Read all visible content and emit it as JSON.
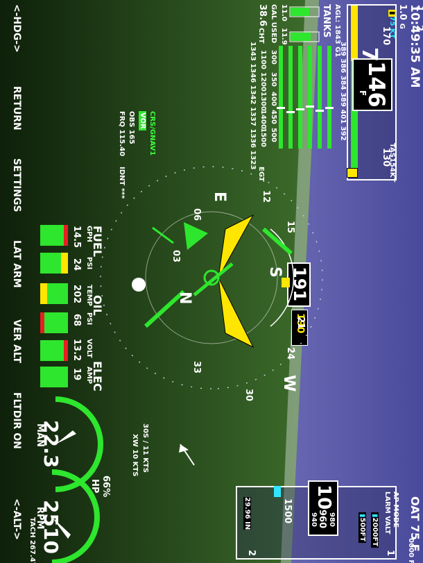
{
  "top_bar": {
    "time": "10:49:35 AM",
    "g_load": "1.0",
    "g_unit": "G",
    "oat": "OAT 75 F"
  },
  "airspeed": {
    "current": "146",
    "selected": "75",
    "selected_unit": "KT",
    "tas": "TAS154",
    "tas_unit": "KT",
    "trend": "7",
    "trend_sub": "F",
    "ticks": [
      "170",
      "160",
      "150",
      "140",
      "130"
    ]
  },
  "altitude": {
    "current_main": "10",
    "current_small": "960",
    "current_small_upper": "980",
    "current_small_lower": "940",
    "selected": "2000",
    "selected_unit": "FT",
    "vsi_select": "500",
    "vsi_unit": "FT",
    "vs_rate": "0000",
    "vs_unit": "FM",
    "baro": "29.96",
    "baro_unit": "IN",
    "ticks": [
      "1500"
    ],
    "scale_marks": [
      "2",
      "1",
      "1",
      "2"
    ],
    "ap_mode_line1": "AP MODE",
    "ap_mode_line2": "LARM VALT"
  },
  "heading": {
    "current": "191",
    "bug": "190",
    "compass_labels": [
      "S",
      "21",
      "24",
      "W",
      "30",
      "33",
      "N",
      "03",
      "06",
      "E",
      "12",
      "15"
    ]
  },
  "nav": {
    "source": "CRS/GNAV1",
    "mode": "VOR",
    "obs": "OBS 165",
    "freq": "FRQ 115.40",
    "ident": "IDNT ***"
  },
  "wind": {
    "line1": "30S / 11 KTS",
    "line2": "XW 10 KTS"
  },
  "engine": {
    "agl": "AGL: 1843 G1",
    "tanks_label": "TANKS",
    "tank_left": "11.0",
    "tank_right": "11.9",
    "gal_used_label": "GAL USED",
    "gal_used": "38.6",
    "cht_label": "CHT",
    "cht_values": [
      "1343",
      "1346",
      "1342",
      "1337",
      "1336",
      "1323"
    ],
    "egt_label": "EGT",
    "cht_scale": [
      "500",
      "450",
      "400",
      "350",
      "300"
    ],
    "egt_scale": [
      "1500",
      "1400",
      "1300",
      "1200",
      "1100"
    ],
    "egt_top_values": [
      "389",
      "386",
      "384",
      "389",
      "401",
      "392"
    ],
    "fuel_label": "FUEL",
    "oil_label": "OIL",
    "elec_label": "ELEC",
    "gph_label": "GPH",
    "psi_label": "PSI",
    "temp_label": "TEMP",
    "psi2_label": "PSI",
    "volt_label": "VOLT",
    "amp_label": "AMP",
    "gph": "14.5",
    "fuel_psi": "24",
    "oil_temp": "202",
    "oil_psi": "68",
    "volt": "13.2",
    "amp": "19",
    "man_value": "22.3",
    "man_label": "MAN",
    "hp_pct": "66%",
    "hp_label": "HP",
    "rpm_value": "2510",
    "rpm_label": "RPM",
    "tach": "TACH 267.47"
  },
  "softkeys": [
    "<-HDG->",
    "RETURN",
    "SETTINGS",
    "LAT ARM",
    "VER ALT",
    "FLTDIR ON",
    "<-ALT->"
  ],
  "colors": {
    "sky": "#5c5ca8",
    "ground": "#2a5a1a",
    "green": "#2ee62e",
    "yellow": "#ffe600",
    "red": "#e62020",
    "cyan": "#2ee6ff"
  }
}
